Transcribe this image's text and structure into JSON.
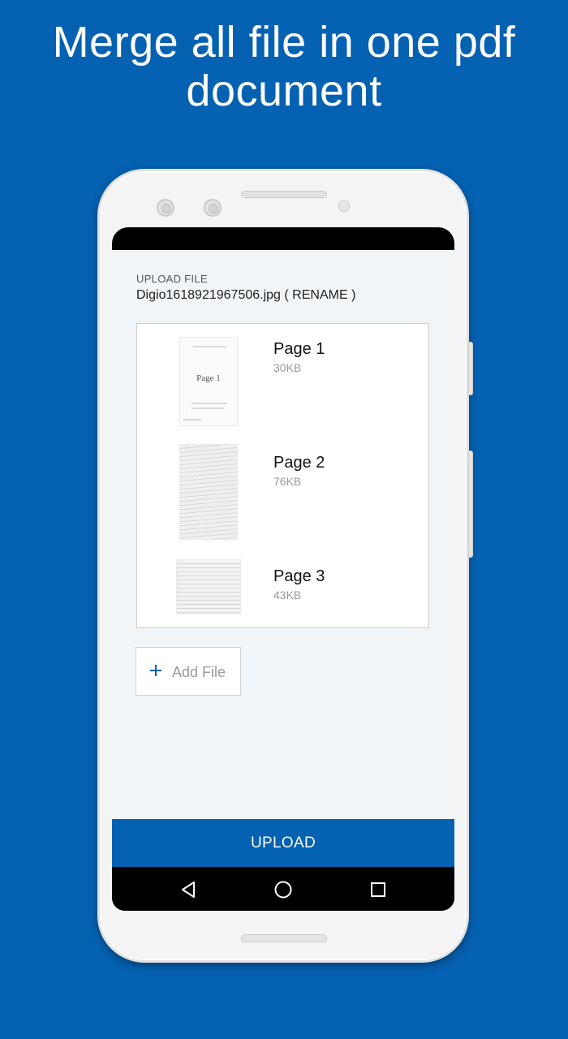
{
  "headline": {
    "line1": "Merge all file in one pdf",
    "line2": "document"
  },
  "upload": {
    "label": "UPLOAD FILE",
    "file_name": "Digio1618921967506.jpg",
    "rename_label": "( RENAME )"
  },
  "pages": [
    {
      "name": "Page 1",
      "size": "30KB",
      "thumb_text": "Page 1"
    },
    {
      "name": "Page 2",
      "size": "76KB"
    },
    {
      "name": "Page 3",
      "size": "43KB"
    }
  ],
  "add_file": {
    "icon": "plus-icon",
    "label": "Add File"
  },
  "upload_button": {
    "label": "UPLOAD"
  },
  "colors": {
    "brand": "#0561B1",
    "screen_bg": "#F2F5F8"
  },
  "navbar": {
    "icons": [
      "back-triangle-icon",
      "home-circle-icon",
      "recents-square-icon"
    ]
  }
}
